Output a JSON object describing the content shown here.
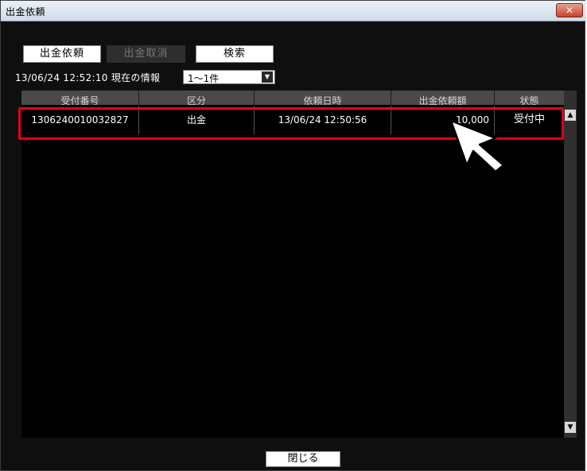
{
  "window": {
    "title": "出金依頼",
    "close_label": "✕"
  },
  "toolbar": {
    "request_label": "出金依頼",
    "cancel_label": "出金取消",
    "search_label": "検索"
  },
  "info": {
    "timestamp_text": "13/06/24 12:52:10 現在の情報",
    "range_value": "1～1件"
  },
  "table": {
    "columns": [
      "受付番号",
      "区分",
      "依頼日時",
      "出金依頼額",
      "状態"
    ],
    "rows": [
      {
        "receipt_no": "1306240010032827",
        "category": "出金",
        "request_datetime": "13/06/24 12:50:56",
        "amount": "10,000",
        "status": "受付中"
      }
    ]
  },
  "footer": {
    "close_label": "閉じる"
  },
  "colors": {
    "highlight": "#e60012",
    "background": "#000000",
    "header": "#4a4a4a"
  },
  "icons": [
    "close-icon",
    "dropdown-arrow-icon",
    "scroll-up-icon",
    "scroll-down-icon",
    "pointer-cursor-icon"
  ]
}
